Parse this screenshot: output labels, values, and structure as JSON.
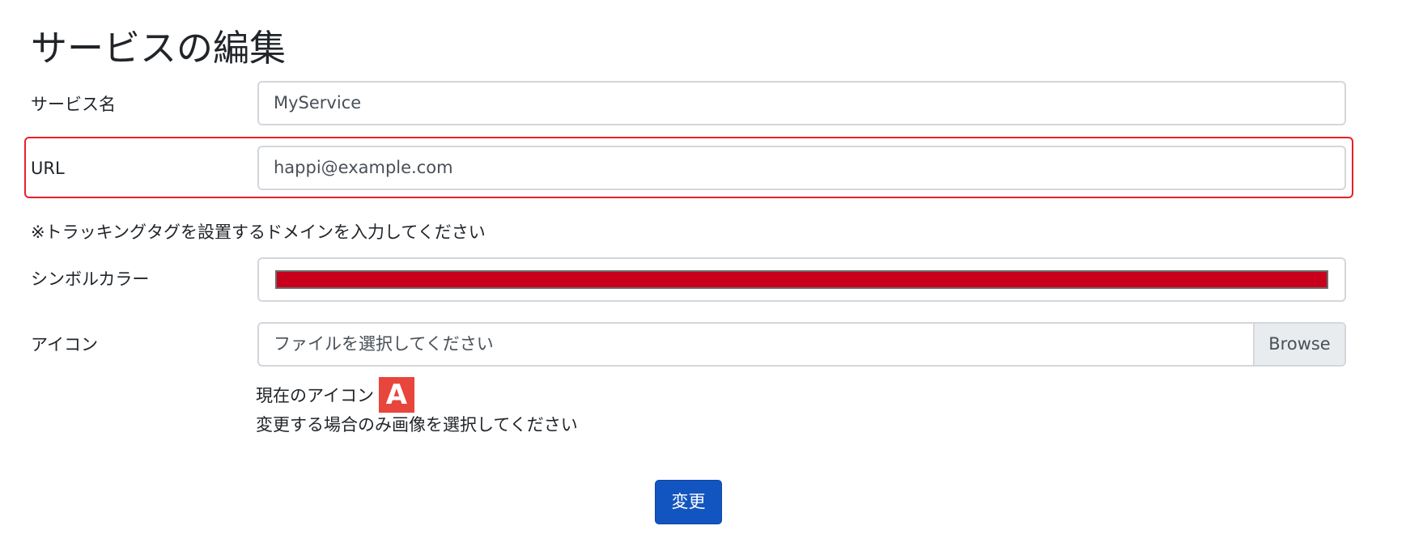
{
  "page": {
    "title": "サービスの編集"
  },
  "form": {
    "service_name": {
      "label": "サービス名",
      "value": "MyService"
    },
    "url": {
      "label": "URL",
      "placeholder": "happi@example.com"
    },
    "hint": "※トラッキングタグを設置するドメインを入力してください",
    "symbol_color": {
      "label": "シンボルカラー",
      "value": "#c8001c"
    },
    "icon": {
      "label": "アイコン",
      "placeholder": "ファイルを選択してください",
      "browse_label": "Browse",
      "current_label": "現在のアイコン",
      "current_letter": "A",
      "current_color": "#e8453c",
      "note": "変更する場合のみ画像を選択してください"
    },
    "submit_label": "変更"
  },
  "colors": {
    "highlight": "#e8202a",
    "primary_button": "#1355c0"
  }
}
